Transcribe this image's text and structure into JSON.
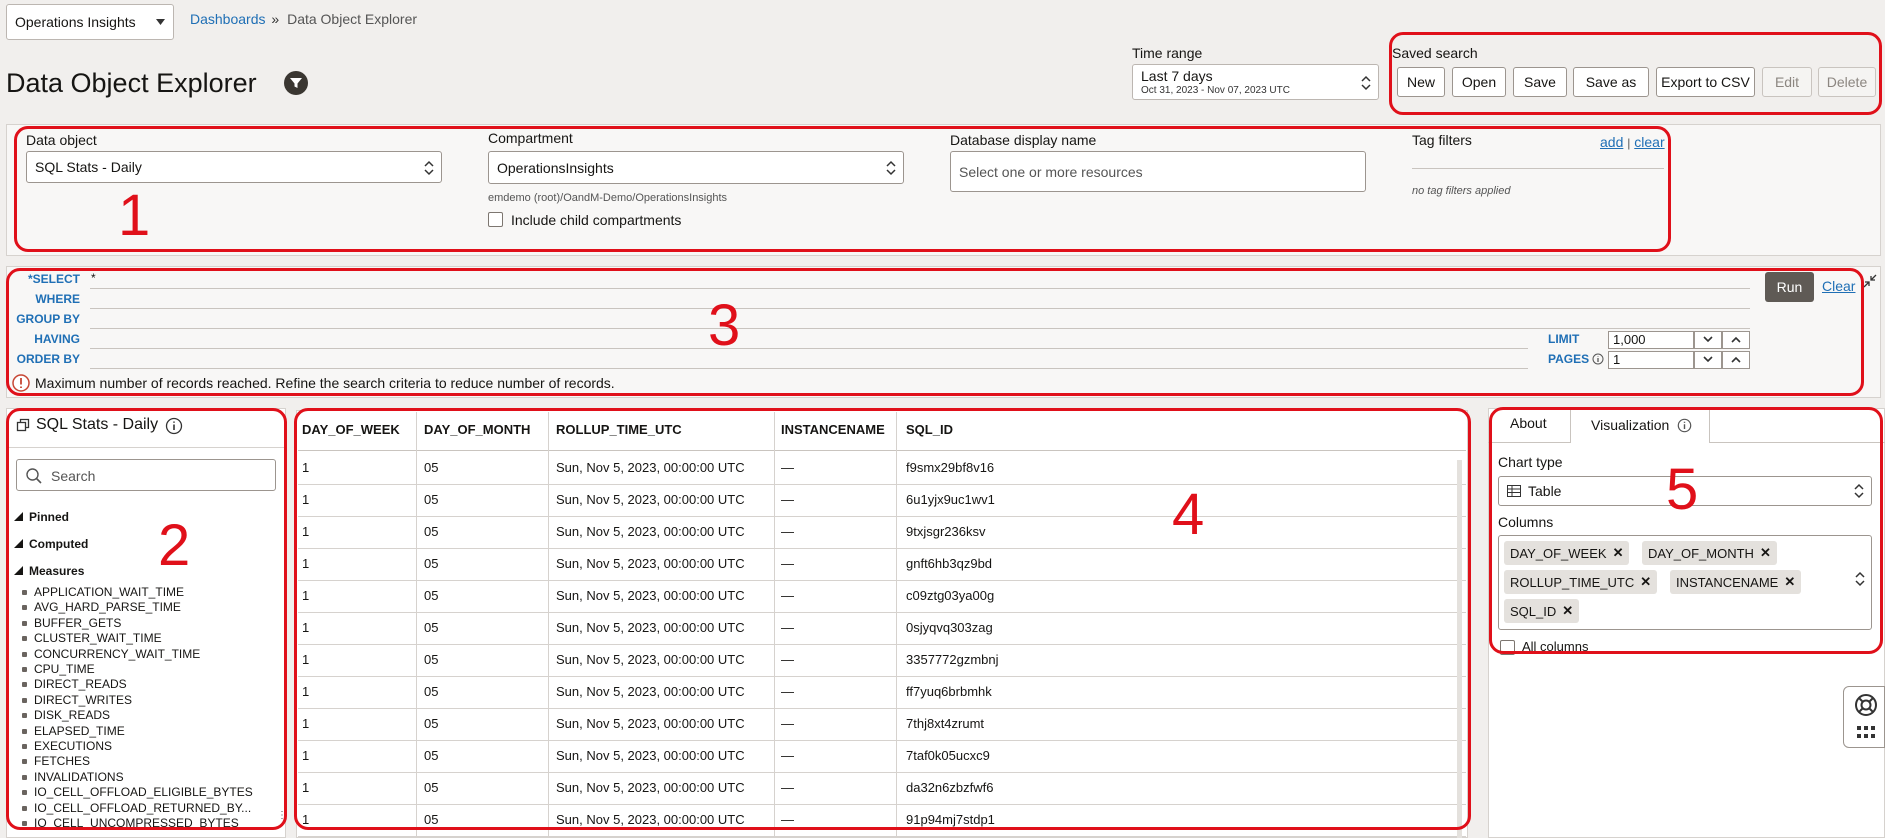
{
  "header": {
    "app_select": "Operations Insights",
    "breadcrumb_link": "Dashboards",
    "breadcrumb_sep": "»",
    "breadcrumb_current": "Data Object Explorer",
    "page_title": "Data Object Explorer",
    "time_range_label": "Time range",
    "time_range_value": "Last 7 days",
    "time_range_sub": "Oct 31, 2023 - Nov 07, 2023 UTC",
    "saved_search_label": "Saved search",
    "buttons": [
      "New",
      "Open",
      "Save",
      "Save as",
      "Export to CSV",
      "Edit",
      "Delete"
    ]
  },
  "filters": {
    "data_object_label": "Data object",
    "data_object_value": "SQL Stats - Daily",
    "compartment_label": "Compartment",
    "compartment_value": "OperationsInsights",
    "compartment_path": "emdemo (root)/OandM-Demo/OperationsInsights",
    "include_child": "Include child compartments",
    "db_display_label": "Database display name",
    "db_display_placeholder": "Select one or more resources",
    "tag_filters_label": "Tag filters",
    "tag_add": "add",
    "tag_sep": "|",
    "tag_clear": "clear",
    "tag_none": "no tag filters applied"
  },
  "query": {
    "select_label": "*SELECT",
    "select_value": "*",
    "where_label": "WHERE",
    "group_by_label": "GROUP BY",
    "having_label": "HAVING",
    "order_by_label": "ORDER BY",
    "limit_label": "LIMIT",
    "limit_value": "1,000",
    "pages_label": "PAGES",
    "pages_value": "1",
    "run": "Run",
    "clear": "Clear",
    "warning": "Maximum number of records reached. Refine the search criteria to reduce number of records."
  },
  "tree": {
    "title": "SQL Stats - Daily",
    "search_placeholder": "Search",
    "groups": [
      "Pinned",
      "Computed",
      "Measures"
    ],
    "measures": [
      "APPLICATION_WAIT_TIME",
      "AVG_HARD_PARSE_TIME",
      "BUFFER_GETS",
      "CLUSTER_WAIT_TIME",
      "CONCURRENCY_WAIT_TIME",
      "CPU_TIME",
      "DIRECT_READS",
      "DIRECT_WRITES",
      "DISK_READS",
      "ELAPSED_TIME",
      "EXECUTIONS",
      "FETCHES",
      "INVALIDATIONS",
      "IO_CELL_OFFLOAD_ELIGIBLE_BYTES",
      "IO_CELL_OFFLOAD_RETURNED_BY...",
      "IO_CELL_UNCOMPRESSED_BYTES"
    ]
  },
  "table": {
    "columns": [
      "DAY_OF_WEEK",
      "DAY_OF_MONTH",
      "ROLLUP_TIME_UTC",
      "INSTANCENAME",
      "SQL_ID"
    ],
    "rows": [
      [
        "1",
        "05",
        "Sun, Nov 5, 2023, 00:00:00 UTC",
        "—",
        "f9smx29bf8v16"
      ],
      [
        "1",
        "05",
        "Sun, Nov 5, 2023, 00:00:00 UTC",
        "—",
        "6u1yjx9uc1wv1"
      ],
      [
        "1",
        "05",
        "Sun, Nov 5, 2023, 00:00:00 UTC",
        "—",
        "9txjsgr236ksv"
      ],
      [
        "1",
        "05",
        "Sun, Nov 5, 2023, 00:00:00 UTC",
        "—",
        "gnft6hb3qz9bd"
      ],
      [
        "1",
        "05",
        "Sun, Nov 5, 2023, 00:00:00 UTC",
        "—",
        "c09ztg03ya00g"
      ],
      [
        "1",
        "05",
        "Sun, Nov 5, 2023, 00:00:00 UTC",
        "—",
        "0sjyqvq303zag"
      ],
      [
        "1",
        "05",
        "Sun, Nov 5, 2023, 00:00:00 UTC",
        "—",
        "3357772gzmbnj"
      ],
      [
        "1",
        "05",
        "Sun, Nov 5, 2023, 00:00:00 UTC",
        "—",
        "ff7yuq6brbmhk"
      ],
      [
        "1",
        "05",
        "Sun, Nov 5, 2023, 00:00:00 UTC",
        "—",
        "7thj8xt4zrumt"
      ],
      [
        "1",
        "05",
        "Sun, Nov 5, 2023, 00:00:00 UTC",
        "—",
        "7taf0k05ucxc9"
      ],
      [
        "1",
        "05",
        "Sun, Nov 5, 2023, 00:00:00 UTC",
        "—",
        "da32n6zbzfwf6"
      ],
      [
        "1",
        "05",
        "Sun, Nov 5, 2023, 00:00:00 UTC",
        "—",
        "91p94mj7stdp1"
      ]
    ]
  },
  "viz": {
    "tab_about": "About",
    "tab_visualization": "Visualization",
    "chart_type_label": "Chart type",
    "chart_type_value": "Table",
    "columns_label": "Columns",
    "chips": [
      "DAY_OF_WEEK",
      "DAY_OF_MONTH",
      "ROLLUP_TIME_UTC",
      "INSTANCENAME",
      "SQL_ID"
    ],
    "all_columns": "All columns"
  },
  "annotations": [
    "1",
    "2",
    "3",
    "4",
    "5"
  ],
  "colors": {
    "annotation": "#e0101a",
    "link": "#1f6fb5",
    "run_button": "#5f5a55"
  }
}
